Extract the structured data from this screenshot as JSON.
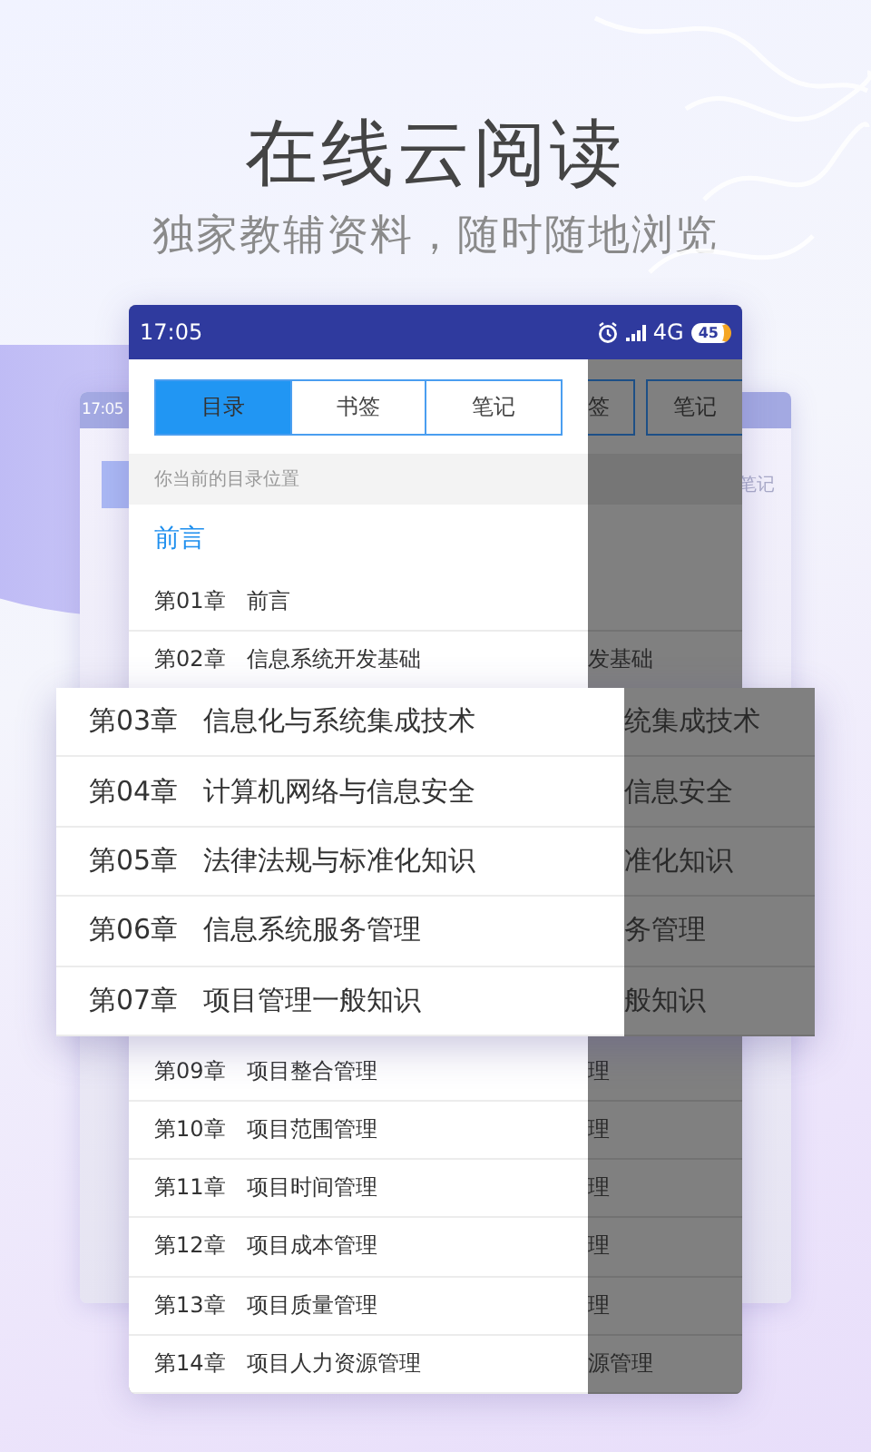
{
  "headline": "在线云阅读",
  "subtitle": "独家教辅资料，随时随地浏览",
  "back_screen": {
    "time": "17:05",
    "tab_label": "笔记"
  },
  "phone": {
    "status_bar": {
      "time": "17:05",
      "network": "4G",
      "battery": "45"
    },
    "tabs": [
      {
        "label": "目录",
        "selected": true
      },
      {
        "label": "书签",
        "selected": false
      },
      {
        "label": "笔记",
        "selected": false
      }
    ],
    "behind_tabs": [
      "签",
      "笔记"
    ],
    "section_header": "你当前的目录位置",
    "current_entry": "前言",
    "chapters_top": [
      {
        "number": "第01章",
        "title": "前言"
      },
      {
        "number": "第02章",
        "title": "信息系统开发基础",
        "behind": "发基础"
      }
    ],
    "chapters_bottom": [
      {
        "number": "第09章",
        "title": "项目整合管理",
        "behind": "理"
      },
      {
        "number": "第10章",
        "title": "项目范围管理",
        "behind": "理"
      },
      {
        "number": "第11章",
        "title": "项目时间管理",
        "behind": "理"
      },
      {
        "number": "第12章",
        "title": "项目成本管理",
        "behind": "理"
      },
      {
        "number": "第13章",
        "title": "项目质量管理",
        "behind": "理"
      },
      {
        "number": "第14章",
        "title": "项目人力资源管理",
        "behind": "源管理"
      }
    ]
  },
  "popout": {
    "chapters": [
      {
        "number": "第03章",
        "title": "信息化与系统集成技术",
        "behind": "统集成技术"
      },
      {
        "number": "第04章",
        "title": "计算机网络与信息安全",
        "behind": "信息安全"
      },
      {
        "number": "第05章",
        "title": "法律法规与标准化知识",
        "behind": "准化知识"
      },
      {
        "number": "第06章",
        "title": "信息系统服务管理",
        "behind": "务管理"
      },
      {
        "number": "第07章",
        "title": "项目管理一般知识",
        "behind": "般知识"
      }
    ]
  }
}
